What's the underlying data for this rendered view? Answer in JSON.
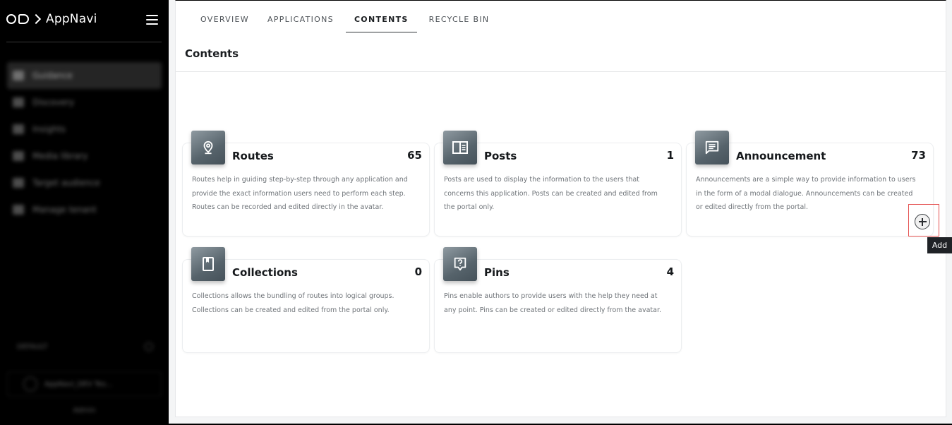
{
  "app": {
    "name": "AppNavi"
  },
  "sidebar": {
    "nav_items": [
      {
        "label": "Guidance",
        "active": true
      },
      {
        "label": "Discovery"
      },
      {
        "label": "Insights"
      },
      {
        "label": "Media library"
      },
      {
        "label": "Target audience"
      },
      {
        "label": "Manage tenant"
      }
    ],
    "footer": {
      "section_label": "DEFAULT",
      "account_label": "AppNavi_DEV Tes...",
      "user_label": "Admin"
    }
  },
  "tabs": [
    {
      "label": "OVERVIEW"
    },
    {
      "label": "APPLICATIONS"
    },
    {
      "label": "CONTENTS",
      "active": true
    },
    {
      "label": "RECYCLE BIN"
    }
  ],
  "page": {
    "title": "Contents"
  },
  "cards": [
    {
      "key": "routes",
      "title": "Routes",
      "count": "65",
      "icon": "location-pin-icon",
      "description": "Routes help in guiding step-by-step through any application and provide the exact information users need to perform each step. Routes can be recorded and edited directly in the avatar."
    },
    {
      "key": "posts",
      "title": "Posts",
      "count": "1",
      "icon": "post-layout-icon",
      "description": "Posts are used to display the information to the users that concerns this application. Posts can be created and edited from the portal only."
    },
    {
      "key": "announcement",
      "title": "Announcement",
      "count": "73",
      "icon": "message-lines-icon",
      "description": "Announcements are a simple way to provide information to users in the form of a modal dialogue. Announcements can be created or edited directly from the portal."
    },
    {
      "key": "collections",
      "title": "Collections",
      "count": "0",
      "icon": "bookmark-book-icon",
      "description": "Collections allows the bundling of routes into logical groups. Collections can be created and edited from the portal only."
    },
    {
      "key": "pins",
      "title": "Pins",
      "count": "4",
      "icon": "help-bubble-icon",
      "description": "Pins enable authors to provide users with the help they need at any point. Pins can be created or edited directly from the avatar."
    }
  ],
  "add_button": {
    "tooltip": "Add"
  },
  "colors": {
    "sidebar_bg": "#000000",
    "icon_tile": "#5b676f",
    "highlight": "#e4504f"
  }
}
